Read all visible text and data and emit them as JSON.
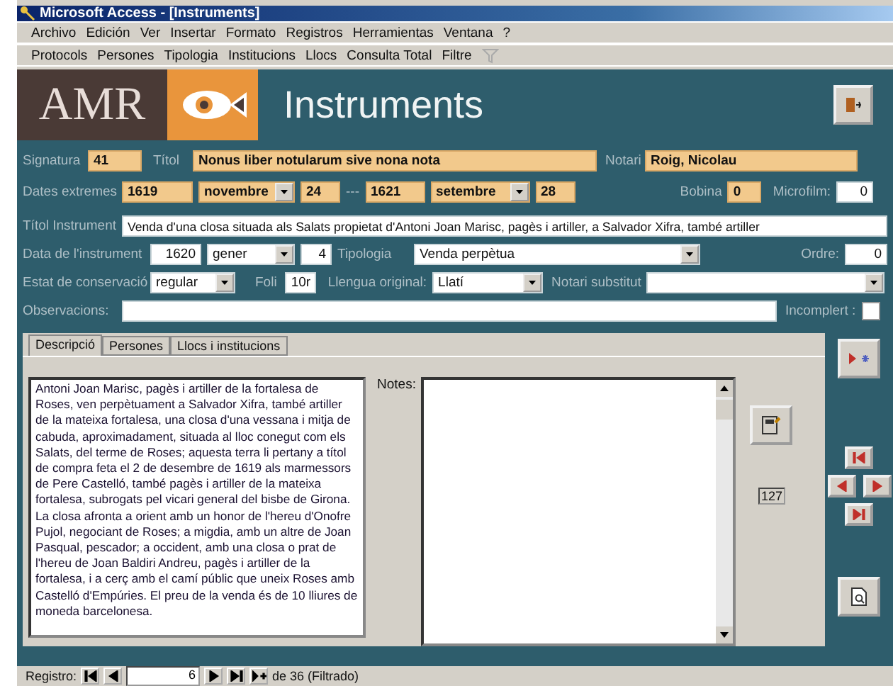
{
  "window": {
    "title": "Microsoft Access - [Instruments]"
  },
  "menu": [
    "Archivo",
    "Edición",
    "Ver",
    "Insertar",
    "Formato",
    "Registros",
    "Herramientas",
    "Ventana",
    "?"
  ],
  "toolbar": [
    "Protocols",
    "Persones",
    "Tipologia",
    "Institucions",
    "Llocs",
    "Consulta Total",
    "Filtre"
  ],
  "header": {
    "logo": "AMR",
    "title": "Instruments"
  },
  "form": {
    "signatura": {
      "label": "Signatura",
      "value": "41",
      "highlighted": true
    },
    "titol": {
      "label": "Títol",
      "value": "Nonus liber notularum sive nona nota",
      "highlighted": true
    },
    "notari": {
      "label": "Notari",
      "value": "Roig, Nicolau",
      "highlighted": true
    },
    "dates": {
      "label": "Dates extremes",
      "from": {
        "year": "1619",
        "month": "novembre",
        "day": "24"
      },
      "separator": "---",
      "to": {
        "year": "1621",
        "month": "setembre",
        "day": "28"
      },
      "highlighted": true
    },
    "bobina": {
      "label": "Bobina",
      "value": "0",
      "highlighted": true
    },
    "microfilm": {
      "label": "Microfilm:",
      "value": "0",
      "highlighted": false
    },
    "titol_instrument": {
      "label": "Títol Instrument",
      "value": "Venda d'una closa situada als Salats propietat d'Antoni Joan Marisc, pagès i artiller, a Salvador Xifra, també artiller"
    },
    "data_instrument": {
      "label": "Data de l'instrument",
      "year": "1620",
      "month": "gener",
      "day": "4"
    },
    "tipologia": {
      "label": "Tipologia",
      "value": "Venda perpètua"
    },
    "ordre": {
      "label": "Ordre:",
      "value": "0"
    },
    "estat": {
      "label": "Estat de conservació",
      "value": "regular"
    },
    "foli": {
      "label": "Foli",
      "value": "10r"
    },
    "llengua": {
      "label": "Llengua original:",
      "value": "Llatí"
    },
    "notari_substitut": {
      "label": "Notari substitut"
    },
    "observacions": {
      "label": "Observacions:"
    },
    "incomplert": {
      "label": "Incomplert :",
      "checked": false
    }
  },
  "tabs": [
    {
      "label": "Descripció",
      "selected": true
    },
    {
      "label": "Persones",
      "selected": false
    },
    {
      "label": "Llocs i institucions",
      "selected": false
    }
  ],
  "description": "Antoni Joan Marisc, pagès i artiller de la fortalesa de Roses, ven perpètuament a Salvador Xifra, també artiller de la mateixa fortalesa, una closa d'una vessana i mitja de cabuda, aproximadament, situada al lloc conegut com els Salats, del terme de Roses; aquesta terra li pertany a títol de compra feta el 2 de desembre de 1619 als marmessors de Pere Castelló, també pagès i artiller de la mateixa fortalesa, subrogats pel vicari general del bisbe de Girona. La closa afronta a orient amb un honor de l'hereu d'Onofre Pujol, negociant de Roses; a migdia, amb un altre de Joan Pasqual, pescador; a occident, amb una closa o prat de l'hereu de Joan Baldiri Andreu, pagès i artiller de la fortalesa, i a cerç amb el camí públic que uneix Roses amb Castelló d'Empúries. El preu de la venda és de 10 lliures de moneda barcelonesa.",
  "notes": {
    "label": "Notes:"
  },
  "counter": "127",
  "status_bar": {
    "label": "Registro:",
    "record": "6",
    "total": "de 36 (Filtrado)"
  }
}
